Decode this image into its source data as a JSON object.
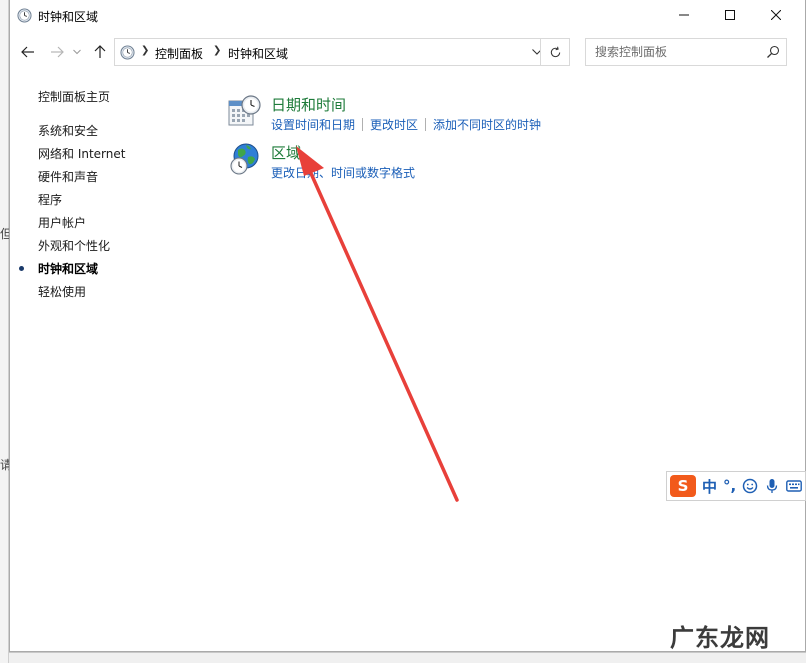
{
  "window": {
    "title": "时钟和区域"
  },
  "background": {
    "left_marks": [
      "但",
      "请"
    ]
  },
  "nav": {
    "breadcrumb": [
      "控制面板",
      "时钟和区域"
    ],
    "search_placeholder": "搜索控制面板"
  },
  "sidebar": {
    "home": "控制面板主页",
    "items": [
      {
        "label": "系统和安全"
      },
      {
        "label": "网络和 Internet"
      },
      {
        "label": "硬件和声音"
      },
      {
        "label": "程序"
      },
      {
        "label": "用户帐户"
      },
      {
        "label": "外观和个性化"
      },
      {
        "label": "时钟和区域",
        "current": true
      },
      {
        "label": "轻松使用"
      }
    ]
  },
  "categories": [
    {
      "title": "日期和时间",
      "icon": "calendar-clock-icon",
      "links": [
        "设置时间和日期",
        "更改时区",
        "添加不同时区的时钟"
      ]
    },
    {
      "title": "区域",
      "icon": "globe-clock-icon",
      "links": [
        "更改日期、时间或数字格式"
      ]
    }
  ],
  "ime": {
    "logo": "S",
    "lang": "中",
    "punct": "°,"
  },
  "watermark": "广东龙网",
  "colors": {
    "category_title": "#1e7b3a",
    "link": "#1b5fb8",
    "annotation_arrow": "#e8403a",
    "ime_logo": "#f25a1b"
  }
}
